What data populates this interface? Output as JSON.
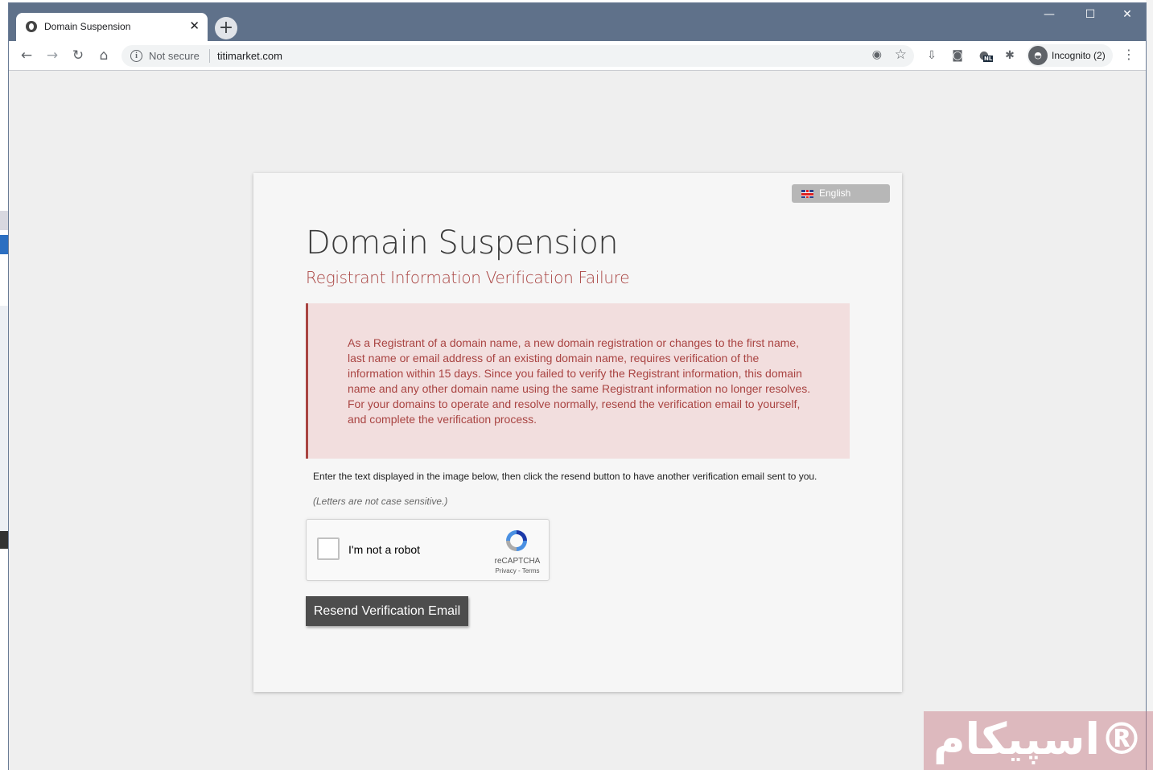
{
  "browser": {
    "tab_title": "Domain Suspension",
    "tab_close": "✕",
    "new_tab": "+",
    "window_controls": {
      "minimize": "—",
      "maximize": "☐",
      "close": "✕"
    },
    "security_label": "Not secure",
    "url": "titimarket.com",
    "profile_label": "Incognito (2)",
    "extension_badge": "NL"
  },
  "page": {
    "language": "English",
    "title": "Domain Suspension",
    "subtitle": "Registrant Information Verification Failure",
    "alert_text": "As a Registrant of a domain name, a new domain registration or changes to the first name, last name or email address of an existing domain name, requires verification of the information within 15 days. Since you failed to verify the Registrant information, this domain name and any other domain name using the same Registrant information no longer resolves. For your domains to operate and resolve normally, resend the verification email to yourself, and complete the verification process.",
    "instructions": "Enter the text displayed in the image below, then click the resend button to have another verification email sent to you.",
    "hint": "(Letters are not case sensitive.)",
    "captcha": {
      "label": "I'm not a robot",
      "brand": "reCAPTCHA",
      "links": "Privacy - Terms"
    },
    "resend_label": "Resend Verification Email"
  },
  "watermark": "اسپیکام®",
  "colors": {
    "titlebar": "#5f718a",
    "alert_bg": "#f2dede",
    "alert_text": "#a94442",
    "button_bg": "#4d4d4d"
  }
}
